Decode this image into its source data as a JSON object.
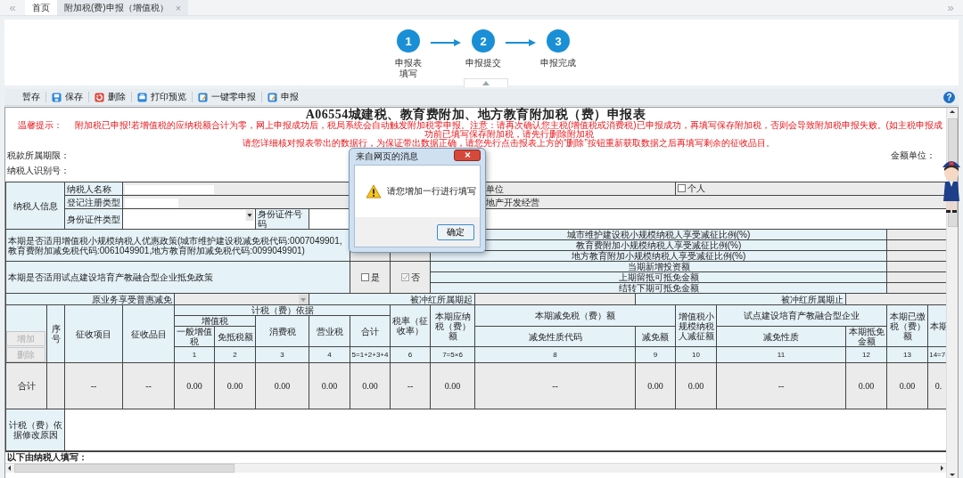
{
  "nav": {
    "back": "«",
    "forward": "»"
  },
  "tabs": [
    {
      "label": "首页",
      "selected": false
    },
    {
      "label": "附加税(费)申报（增值税）",
      "selected": true,
      "close": "×"
    }
  ],
  "steps": [
    {
      "number": "1",
      "label": "申报表填写"
    },
    {
      "number": "2",
      "label": "申报提交"
    },
    {
      "number": "3",
      "label": "申报完成"
    }
  ],
  "toolbar": [
    {
      "label": "暂存",
      "kind": "plain"
    },
    {
      "label": "保存",
      "kind": "save"
    },
    {
      "label": "删除",
      "kind": "delete"
    },
    {
      "label": "打印预览",
      "kind": "print"
    },
    {
      "label": "一键零申报",
      "kind": "edit"
    },
    {
      "label": "申报",
      "kind": "edit"
    }
  ],
  "help": "?",
  "form": {
    "title": "A06554城建税、教育费附加、地方教育附加税（费）申报表",
    "notice_label": "温馨提示：",
    "notice_lines": [
      "附加税已申报!若增值税的应纳税额合计为零，网上申报成功后，税局系统会自动触发附加税零申报。注意：请再次确认您主税(增值税或消费税)已申报成功，再填写保存附加税，否则会导致附加税申报失败。(如主税申报成功前已填写保存附加税，请先行删除附加税",
      "请您详细核对报表带出的数据行，为保证带出数据正确，请您先行点击报表上方的“删除”按钮重新获取数据之后再填写剩余的征收品目。"
    ],
    "period_label": "税款所属期限：",
    "taxpayer_id_label": "纳税人识别号：",
    "unit_label": "金额单位："
  },
  "taxpayer_info": {
    "label": "纳税人信息",
    "name_label": "纳税人名称",
    "reg_type_label": "登记注册类型",
    "unit_option": "单位",
    "individual": {
      "label": "个人",
      "checked": false
    },
    "industry": "地产开发经营",
    "id_type_label": "身份证件类型",
    "id_number_label": "身份证件号码"
  },
  "small_scale": {
    "question": "本期是否适用增值税小规模纳税人优惠政策(城市维护建设税减免税代码:0007049901,教育费附加减免税代码:0061049901,地方教育附加减免税代码:0099049901)",
    "ratios": [
      "城市维护建设税小规模纳税人享受减征比例(%)",
      "教育费附加小规模纳税人享受减征比例(%)",
      "地方教育附加小规模纳税人享受减征比例(%)"
    ]
  },
  "pilot": {
    "question": "本期是否适用试点建设培育产教融合型企业抵免政策",
    "options": [
      {
        "label": "是",
        "checked": false
      },
      {
        "label": "否",
        "checked": true
      }
    ],
    "amounts": [
      "当期新增投资额",
      "上期留抵可抵免金额",
      "结转下期可抵免金额"
    ]
  },
  "red_reversal": {
    "relief_label": "原业务享受普惠减免",
    "start_label": "被冲红所属期起",
    "end_label": "被冲红所属期止"
  },
  "grid": {
    "add_button": {
      "label": "增加",
      "disabled": true
    },
    "delete_button": {
      "label": "删除",
      "disabled": true
    },
    "headers": {
      "seq": "序号",
      "item": "征收项目",
      "subitem": "征收品目",
      "basis": "计税（费）依据",
      "vat": "增值税",
      "general_vat": "一般增值税",
      "exempt_offset": "免抵税额",
      "consumption": "消费税",
      "business": "营业税",
      "sum": "合计",
      "rate": "税率（征收率）",
      "payable": "本期应纳税（费）额",
      "relief": "本期减免税（费）额",
      "relief_code": "减免性质代码",
      "relief_amount": "减免额",
      "small_scale_reduction": "增值税小规模纳税人减征额",
      "pilot": "试点建设培育产教融合型企业",
      "pilot_nature": "减免性质",
      "pilot_amount": "本期抵免金额",
      "paid": "本期已缴税（费）额",
      "last": "本期"
    },
    "numbers": [
      "1",
      "2",
      "3",
      "4",
      "5=1+2+3+4",
      "6",
      "7=5×6",
      "8",
      "9",
      "10",
      "11",
      "12",
      "13",
      "14=7-"
    ],
    "total_label": "合计",
    "total_cells": [
      "--",
      "--",
      "0.00",
      "0.00",
      "0.00",
      "0.00",
      "0.00",
      "--",
      "0.00",
      "--",
      "0.00",
      "0.00",
      "--",
      "0.00",
      "0.00",
      "0."
    ]
  },
  "reason_label": "计税（费）依据修改原因",
  "footer_note": "以下由纳税人填写：",
  "dialog": {
    "title": "来自网页的消息",
    "message": "请您增加一行进行填写",
    "ok": "确定"
  }
}
